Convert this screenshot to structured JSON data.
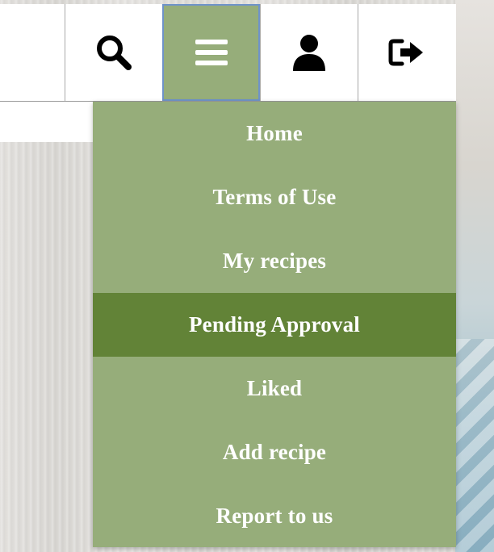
{
  "nav": {
    "icons": [
      "search-icon",
      "hamburger-menu-icon",
      "user-icon",
      "logout-icon"
    ],
    "active": "hamburger-menu-icon"
  },
  "menu": {
    "items": [
      {
        "label": "Home"
      },
      {
        "label": "Terms of Use"
      },
      {
        "label": "My recipes"
      },
      {
        "label": "Pending Approval"
      },
      {
        "label": "Liked"
      },
      {
        "label": "Add recipe"
      },
      {
        "label": "Report to us"
      }
    ],
    "selected": "Pending Approval"
  },
  "colors": {
    "menu_bg": "#96ad7a",
    "menu_selected_bg": "#628337",
    "menu_text": "#ffffff",
    "active_border": "#6f93c9"
  }
}
